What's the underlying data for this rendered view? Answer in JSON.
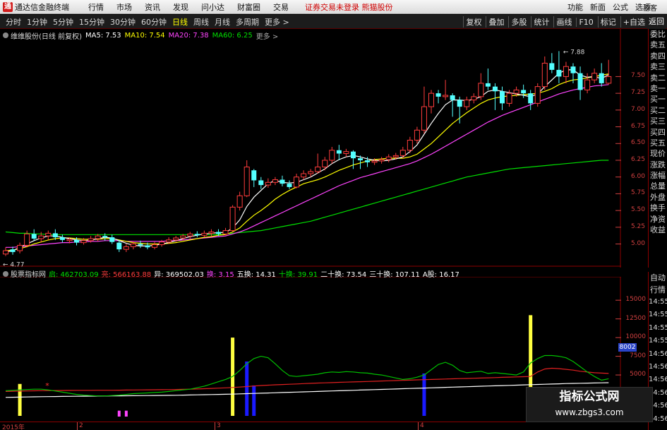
{
  "app": {
    "title": "通达信金融终端",
    "logo": "通"
  },
  "menu": [
    "行情",
    "市场",
    "资讯",
    "发现",
    "问小达",
    "财富圈",
    "交易"
  ],
  "notice": "证券交易未登录  熊猫股份",
  "right_menu": [
    "功能",
    "新面",
    "公式",
    "选项"
  ],
  "guest": "游客",
  "periods": [
    {
      "label": "分时",
      "active": false
    },
    {
      "label": "1分钟",
      "active": false
    },
    {
      "label": "5分钟",
      "active": false
    },
    {
      "label": "15分钟",
      "active": false
    },
    {
      "label": "30分钟",
      "active": false
    },
    {
      "label": "60分钟",
      "active": false
    },
    {
      "label": "日线",
      "active": true
    },
    {
      "label": "周线",
      "active": false
    },
    {
      "label": "月线",
      "active": false
    },
    {
      "label": "多周期",
      "active": false
    },
    {
      "label": "更多 >",
      "active": false
    }
  ],
  "tools": [
    "复权",
    "叠加",
    "多股",
    "统计",
    "画线",
    "F10",
    "标记",
    "+自选"
  ],
  "back_label": "返回",
  "main_header": {
    "stock": "维维股份(日线 前复权)",
    "ma5": "MA5: 7.53",
    "ma10": "MA10: 7.54",
    "ma20": "MA20: 7.38",
    "ma60": "MA60: 6.25"
  },
  "price_ticks": [
    "7.50",
    "7.25",
    "7.00",
    "6.75",
    "6.50",
    "6.25",
    "6.00",
    "5.75",
    "5.50",
    "5.25",
    "5.00"
  ],
  "annotations": {
    "high": "7.88",
    "low": "4.77"
  },
  "orderbook": [
    "委比",
    "卖五",
    "卖四",
    "卖三",
    "卖二",
    "卖一",
    "买一",
    "买二",
    "买三",
    "买四",
    "买五",
    "现价",
    "涨跌",
    "涨幅",
    "总量",
    "外盘",
    "换手",
    "净资",
    "收益"
  ],
  "indicator_header": {
    "name": "股票指标网",
    "qi": "启: 462703.09",
    "liang": "亮: 566163.88",
    "yi": "异: 369502.03",
    "huan": "换: 3.15",
    "wu": "五换: 14.31",
    "shi": "十换: 39.91",
    "ershi": "二十换: 73.54",
    "sanshi": "三十换: 107.11",
    "agu": "A股: 16.17"
  },
  "vol_ticks": [
    "15000",
    "12500",
    "10000",
    "7500",
    "5000",
    "2500"
  ],
  "vol_marker": "8002",
  "time_panel": {
    "title1": "自动",
    "title2": "行情",
    "times": [
      "14:55",
      "14:55",
      "14:55",
      "14:55",
      "14:56",
      "14:56",
      "14:56",
      "14:56",
      "14:56",
      "14:56"
    ]
  },
  "date_ticks": [
    "2015年",
    "2",
    "3",
    "4"
  ],
  "watermark": {
    "title": "指标公式网",
    "url": "www.zbgs3.com"
  },
  "colors": {
    "up": "#ff3c3c",
    "down": "#54ffff",
    "ma5": "#ffffff",
    "ma10": "#ffff00",
    "ma20": "#ff44ff",
    "ma60": "#00e000",
    "axis": "#d04040",
    "border": "#8b0000"
  },
  "chart_data": {
    "type": "candlestick",
    "price_range": [
      4.7,
      8.0
    ],
    "candles": [
      [
        4.85,
        4.9,
        4.95,
        4.82
      ],
      [
        4.92,
        4.88,
        4.96,
        4.84
      ],
      [
        4.9,
        4.98,
        5.02,
        4.86
      ],
      [
        4.98,
        5.15,
        5.2,
        4.95
      ],
      [
        5.15,
        5.08,
        5.22,
        5.05
      ],
      [
        5.08,
        5.12,
        5.18,
        5.02
      ],
      [
        5.12,
        5.16,
        5.2,
        5.06
      ],
      [
        5.16,
        5.1,
        5.22,
        5.06
      ],
      [
        5.1,
        5.06,
        5.14,
        5.02
      ],
      [
        5.05,
        5.07,
        5.1,
        5.01
      ],
      [
        5.06,
        5.02,
        5.1,
        4.98
      ],
      [
        5.02,
        5.05,
        5.09,
        4.99
      ],
      [
        5.05,
        5.08,
        5.12,
        5.02
      ],
      [
        5.08,
        5.12,
        5.15,
        5.04
      ],
      [
        5.12,
        5.1,
        5.16,
        5.05
      ],
      [
        5.1,
        5.03,
        5.14,
        5.0
      ],
      [
        5.02,
        4.92,
        5.06,
        4.88
      ],
      [
        4.92,
        4.96,
        5.0,
        4.88
      ],
      [
        4.96,
        5.0,
        5.04,
        4.92
      ],
      [
        5.0,
        4.98,
        5.05,
        4.94
      ],
      [
        4.98,
        4.95,
        5.02,
        4.92
      ],
      [
        4.95,
        4.99,
        5.03,
        4.92
      ],
      [
        4.99,
        5.03,
        5.06,
        4.96
      ],
      [
        5.03,
        5.06,
        5.1,
        5.0
      ],
      [
        5.06,
        5.09,
        5.12,
        5.03
      ],
      [
        5.09,
        5.12,
        5.15,
        5.05
      ],
      [
        5.12,
        5.15,
        5.18,
        5.08
      ],
      [
        5.15,
        5.13,
        5.19,
        5.1
      ],
      [
        5.13,
        5.16,
        5.2,
        5.1
      ],
      [
        5.16,
        5.18,
        5.22,
        5.12
      ],
      [
        5.18,
        5.15,
        5.22,
        5.12
      ],
      [
        5.15,
        5.2,
        5.24,
        5.13
      ],
      [
        5.2,
        5.55,
        5.58,
        5.18
      ],
      [
        5.55,
        5.72,
        5.78,
        5.5
      ],
      [
        5.72,
        6.15,
        6.25,
        5.7
      ],
      [
        6.1,
        5.95,
        6.12,
        5.85
      ],
      [
        5.95,
        5.88,
        6.0,
        5.82
      ],
      [
        5.88,
        5.92,
        5.98,
        5.84
      ],
      [
        5.92,
        5.96,
        6.0,
        5.88
      ],
      [
        5.96,
        5.9,
        6.02,
        5.86
      ],
      [
        5.9,
        5.85,
        5.95,
        5.82
      ],
      [
        5.85,
        6.0,
        6.05,
        5.83
      ],
      [
        6.0,
        6.05,
        6.1,
        5.96
      ],
      [
        6.05,
        6.08,
        6.12,
        6.0
      ],
      [
        6.08,
        6.15,
        6.35,
        6.05
      ],
      [
        6.15,
        6.25,
        6.3,
        6.1
      ],
      [
        6.25,
        6.4,
        6.45,
        6.2
      ],
      [
        6.4,
        6.35,
        6.48,
        6.25
      ],
      [
        6.35,
        6.38,
        6.42,
        6.3
      ],
      [
        6.38,
        6.28,
        6.4,
        6.12
      ],
      [
        6.28,
        6.25,
        6.32,
        6.12
      ],
      [
        6.25,
        6.22,
        6.3,
        6.15
      ],
      [
        6.22,
        6.24,
        6.28,
        6.18
      ],
      [
        6.24,
        6.26,
        6.3,
        6.2
      ],
      [
        6.26,
        6.3,
        6.34,
        6.22
      ],
      [
        6.3,
        6.32,
        6.36,
        6.26
      ],
      [
        6.32,
        6.4,
        6.45,
        6.28
      ],
      [
        6.4,
        6.55,
        6.6,
        6.36
      ],
      [
        6.55,
        6.7,
        6.75,
        6.5
      ],
      [
        6.7,
        7.05,
        7.35,
        6.65
      ],
      [
        7.05,
        7.25,
        7.3,
        6.95
      ],
      [
        7.25,
        7.2,
        7.3,
        7.1
      ],
      [
        7.2,
        7.22,
        7.45,
        7.15
      ],
      [
        7.22,
        7.15,
        7.25,
        6.9
      ],
      [
        7.15,
        7.05,
        7.2,
        6.8
      ],
      [
        7.05,
        7.15,
        7.2,
        7.0
      ],
      [
        7.15,
        7.2,
        7.25,
        7.1
      ],
      [
        7.2,
        7.4,
        7.55,
        7.15
      ],
      [
        7.4,
        7.35,
        7.62,
        7.3
      ],
      [
        7.35,
        7.28,
        7.4,
        7.0
      ],
      [
        7.28,
        7.1,
        7.35,
        7.0
      ],
      [
        7.1,
        7.25,
        7.3,
        7.05
      ],
      [
        7.25,
        7.3,
        7.35,
        7.2
      ],
      [
        7.3,
        7.25,
        7.38,
        7.18
      ],
      [
        7.25,
        7.1,
        7.3,
        7.0
      ],
      [
        7.1,
        7.35,
        7.4,
        7.05
      ],
      [
        7.35,
        7.7,
        7.8,
        7.3
      ],
      [
        7.7,
        7.6,
        7.85,
        7.55
      ],
      [
        7.6,
        7.5,
        7.88,
        7.4
      ],
      [
        7.5,
        7.65,
        7.72,
        7.4
      ],
      [
        7.65,
        7.55,
        7.7,
        7.4
      ],
      [
        7.55,
        7.3,
        7.65,
        7.15
      ],
      [
        7.3,
        7.45,
        7.55,
        7.25
      ],
      [
        7.45,
        7.55,
        7.62,
        7.4
      ],
      [
        7.55,
        7.4,
        7.7,
        7.35
      ],
      [
        7.4,
        7.5,
        7.75,
        7.38
      ]
    ],
    "ma5": [
      4.88,
      4.9,
      4.95,
      5.0,
      5.05,
      5.09,
      5.12,
      5.12,
      5.1,
      5.08,
      5.06,
      5.05,
      5.06,
      5.08,
      5.1,
      5.09,
      5.05,
      5.01,
      4.98,
      4.97,
      4.97,
      4.98,
      5.0,
      5.02,
      5.05,
      5.08,
      5.11,
      5.13,
      5.15,
      5.16,
      5.17,
      5.17,
      5.24,
      5.36,
      5.56,
      5.7,
      5.8,
      5.9,
      5.95,
      5.92,
      5.91,
      5.92,
      5.96,
      6.0,
      6.06,
      6.12,
      6.2,
      6.26,
      6.3,
      6.32,
      6.3,
      6.27,
      6.25,
      6.24,
      6.25,
      6.27,
      6.3,
      6.38,
      6.48,
      6.64,
      6.8,
      6.95,
      7.08,
      7.15,
      7.15,
      7.14,
      7.16,
      7.2,
      7.28,
      7.3,
      7.28,
      7.26,
      7.24,
      7.22,
      7.2,
      7.24,
      7.35,
      7.45,
      7.55,
      7.6,
      7.6,
      7.52,
      7.49,
      7.5,
      7.47,
      7.53
    ],
    "ma10": [
      4.9,
      4.91,
      4.93,
      4.96,
      5.0,
      5.03,
      5.06,
      5.08,
      5.09,
      5.09,
      5.08,
      5.07,
      5.07,
      5.07,
      5.08,
      5.08,
      5.06,
      5.04,
      5.02,
      5.01,
      5.0,
      5.0,
      5.0,
      5.01,
      5.02,
      5.04,
      5.06,
      5.08,
      5.1,
      5.11,
      5.13,
      5.14,
      5.18,
      5.24,
      5.34,
      5.43,
      5.5,
      5.58,
      5.67,
      5.74,
      5.8,
      5.85,
      5.9,
      5.93,
      5.96,
      6.0,
      6.05,
      6.1,
      6.14,
      6.18,
      6.21,
      6.24,
      6.26,
      6.27,
      6.28,
      6.28,
      6.28,
      6.3,
      6.34,
      6.42,
      6.5,
      6.6,
      6.7,
      6.8,
      6.88,
      6.96,
      7.03,
      7.1,
      7.15,
      7.18,
      7.2,
      7.21,
      7.22,
      7.23,
      7.24,
      7.25,
      7.28,
      7.32,
      7.38,
      7.42,
      7.45,
      7.46,
      7.48,
      7.5,
      7.52,
      7.54
    ],
    "ma20": [
      4.95,
      4.95,
      4.96,
      4.97,
      4.98,
      4.99,
      5.0,
      5.01,
      5.02,
      5.02,
      5.03,
      5.03,
      5.04,
      5.04,
      5.05,
      5.05,
      5.05,
      5.04,
      5.04,
      5.04,
      5.04,
      5.04,
      5.04,
      5.05,
      5.05,
      5.06,
      5.07,
      5.08,
      5.09,
      5.1,
      5.11,
      5.12,
      5.15,
      5.18,
      5.22,
      5.27,
      5.32,
      5.37,
      5.42,
      5.47,
      5.52,
      5.57,
      5.62,
      5.67,
      5.72,
      5.77,
      5.82,
      5.87,
      5.91,
      5.95,
      5.99,
      6.02,
      6.05,
      6.08,
      6.11,
      6.14,
      6.17,
      6.2,
      6.24,
      6.29,
      6.34,
      6.4,
      6.46,
      6.52,
      6.58,
      6.64,
      6.7,
      6.76,
      6.82,
      6.87,
      6.92,
      6.96,
      7.0,
      7.04,
      7.08,
      7.12,
      7.16,
      7.2,
      7.24,
      7.27,
      7.3,
      7.32,
      7.34,
      7.36,
      7.37,
      7.38
    ],
    "ma60": [
      5.18,
      5.17,
      5.16,
      5.16,
      5.15,
      5.15,
      5.14,
      5.14,
      5.14,
      5.14,
      5.14,
      5.14,
      5.14,
      5.14,
      5.14,
      5.14,
      5.14,
      5.14,
      5.14,
      5.14,
      5.14,
      5.14,
      5.14,
      5.14,
      5.14,
      5.14,
      5.14,
      5.14,
      5.14,
      5.14,
      5.14,
      5.15,
      5.16,
      5.17,
      5.18,
      5.19,
      5.2,
      5.22,
      5.24,
      5.26,
      5.28,
      5.3,
      5.32,
      5.34,
      5.37,
      5.4,
      5.43,
      5.46,
      5.49,
      5.52,
      5.55,
      5.58,
      5.61,
      5.64,
      5.67,
      5.7,
      5.73,
      5.76,
      5.79,
      5.82,
      5.85,
      5.88,
      5.91,
      5.94,
      5.97,
      6.0,
      6.02,
      6.04,
      6.06,
      6.08,
      6.1,
      6.12,
      6.13,
      6.14,
      6.15,
      6.16,
      6.17,
      6.18,
      6.19,
      6.2,
      6.21,
      6.22,
      6.23,
      6.24,
      6.25,
      6.25
    ],
    "indicator": {
      "range": [
        0,
        17000
      ],
      "green_line": [
        2900,
        2950,
        3000,
        3050,
        3100,
        3100,
        3000,
        2850,
        2700,
        2550,
        2400,
        2300,
        2250,
        2200,
        2200,
        2250,
        2300,
        2400,
        2500,
        2550,
        2600,
        2650,
        2700,
        2800,
        2900,
        3000,
        3100,
        3300,
        3500,
        3800,
        4100,
        4400,
        4800,
        5600,
        6500,
        7200,
        7500,
        7300,
        6500,
        5600,
        4900,
        4800,
        4900,
        5000,
        5100,
        5300,
        5400,
        5350,
        5450,
        5400,
        5300,
        5250,
        5100,
        5000,
        4800,
        4600,
        4400,
        4500,
        4700,
        5000,
        5700,
        6400,
        6700,
        6300,
        5600,
        5300,
        5400,
        5500,
        5200,
        5300,
        5200,
        5100,
        5000,
        5400,
        6600,
        7200,
        7600,
        7600,
        7500,
        7300,
        6800,
        6100,
        5400,
        4800,
        4300,
        4500
      ],
      "red_line": [
        2800,
        2820,
        2840,
        2860,
        2880,
        2900,
        2910,
        2920,
        2930,
        2940,
        2950,
        2950,
        2950,
        2960,
        2960,
        2960,
        2970,
        2980,
        2990,
        3000,
        3010,
        3020,
        3030,
        3040,
        3060,
        3080,
        3100,
        3130,
        3160,
        3200,
        3240,
        3280,
        3320,
        3380,
        3450,
        3520,
        3590,
        3640,
        3680,
        3720,
        3760,
        3800,
        3840,
        3880,
        3920,
        3950,
        3980,
        4010,
        4040,
        4070,
        4100,
        4130,
        4160,
        4190,
        4220,
        4250,
        4280,
        4310,
        4340,
        4370,
        4400,
        4430,
        4460,
        4490,
        4510,
        4530,
        4560,
        4590,
        4620,
        4650,
        4680,
        4710,
        4740,
        4770,
        4800,
        5400,
        5800,
        5900,
        5850,
        5750,
        5650,
        5500,
        5400,
        5300,
        5250,
        5200
      ],
      "white_line": [
        2000,
        2020,
        2040,
        2060,
        2080,
        2100,
        2110,
        2120,
        2130,
        2140,
        2150,
        2160,
        2170,
        2180,
        2190,
        2200,
        2210,
        2220,
        2230,
        2240,
        2250,
        2260,
        2270,
        2280,
        2290,
        2300,
        2320,
        2340,
        2360,
        2380,
        2400,
        2420,
        2440,
        2470,
        2500,
        2530,
        2560,
        2590,
        2620,
        2650,
        2680,
        2710,
        2740,
        2770,
        2800,
        2830,
        2860,
        2890,
        2920,
        2950,
        2980,
        3010,
        3040,
        3070,
        3100,
        3130,
        3160,
        3190,
        3220,
        3250,
        3280,
        3310,
        3340,
        3370,
        3400,
        3430,
        3460,
        3490,
        3520,
        3550,
        3580,
        3610,
        3640,
        3670,
        3700,
        3730,
        3760,
        3790,
        3820,
        3850,
        3870,
        3890,
        3910,
        3930,
        3950,
        3970
      ],
      "yellow_bars": [
        [
          2,
          3800
        ],
        [
          32,
          10000
        ],
        [
          74,
          13000
        ]
      ],
      "blue_bars": [
        [
          34,
          6800
        ],
        [
          35,
          3600
        ],
        [
          59,
          5200
        ]
      ],
      "magenta_bars": [
        [
          16,
          600
        ],
        [
          17,
          600
        ]
      ]
    }
  }
}
